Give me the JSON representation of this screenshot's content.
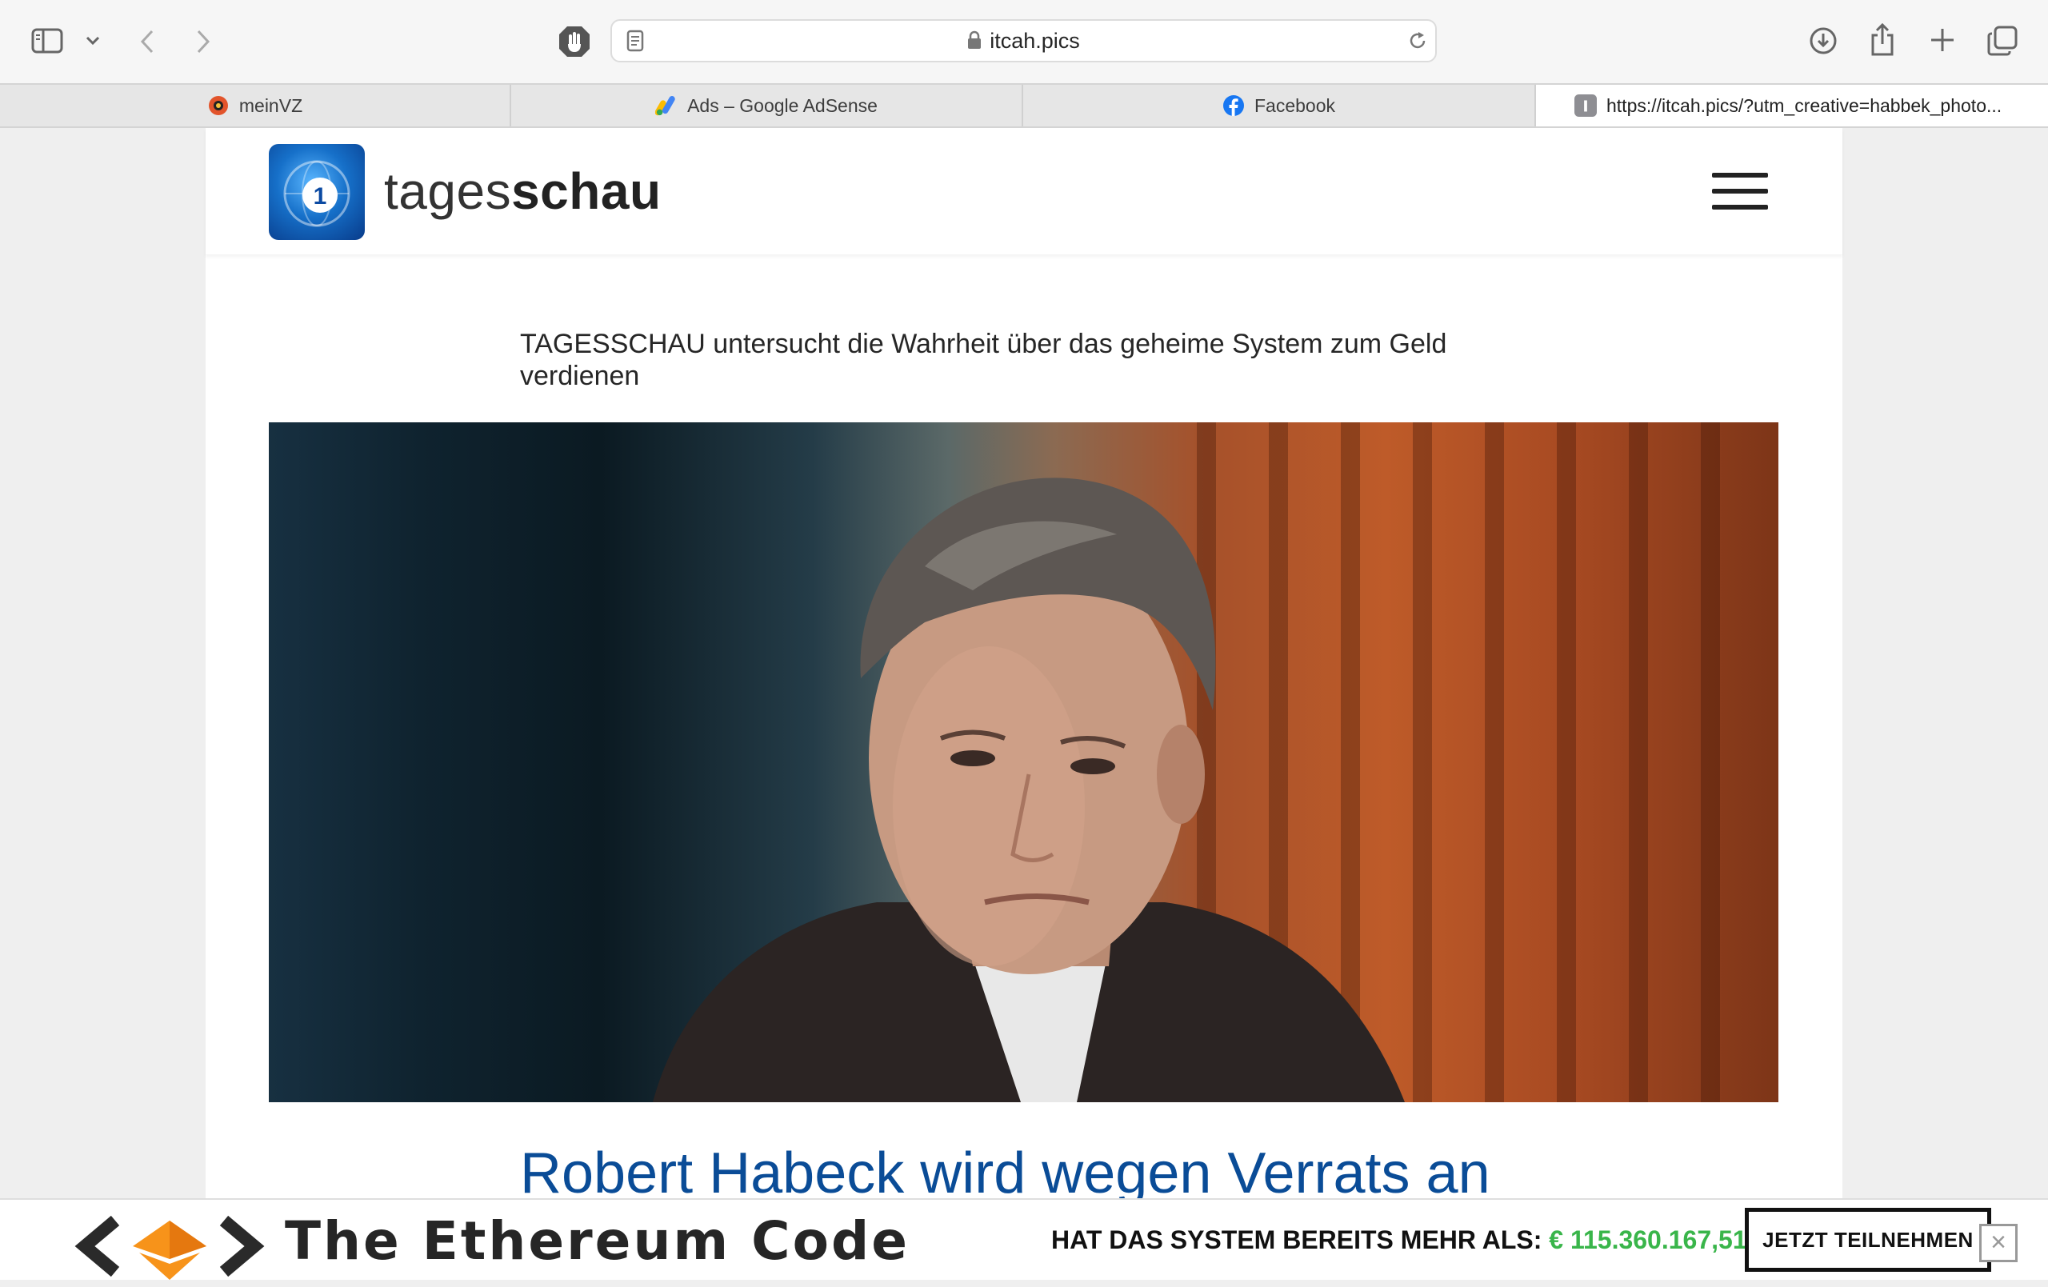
{
  "browser": {
    "url_display": "itcah.pics",
    "icons": [
      "sidebar-icon",
      "chevron-down-icon",
      "back-icon",
      "forward-icon",
      "privacy-hand-icon",
      "reader-icon",
      "lock-icon",
      "reload-icon",
      "download-icon",
      "share-icon",
      "new-tab-plus-icon",
      "tab-overview-icon"
    ],
    "tabs": [
      {
        "label": "meinVZ",
        "icon": "meinvz-icon",
        "active": false
      },
      {
        "label": "Ads – Google AdSense",
        "icon": "adsense-icon",
        "active": false
      },
      {
        "label": "Facebook",
        "icon": "facebook-icon",
        "active": false
      },
      {
        "label": "https://itcah.pics/?utm_creative=habbek_photo...",
        "icon": "site-favicon-icon",
        "active": true
      }
    ]
  },
  "site": {
    "logo_regular": "tages",
    "logo_bold": "schau",
    "menu_icon": "hamburger-menu-icon"
  },
  "article": {
    "lead": "TAGESSCHAU untersucht die Wahrheit über das geheime System zum Geld verdienen",
    "headline": "Robert Habeck wird wegen Verrats an"
  },
  "ad": {
    "brand": "The Ethereum Code",
    "claim": "HAT DAS SYSTEM BEREITS MEHR ALS:",
    "amount": "€ 115.360.167,51",
    "cta": "JETZT TEILNEHMEN",
    "close": "×"
  },
  "colors": {
    "headline": "#0a4c97",
    "amount": "#39b54a",
    "logo_blue": "#1670c9"
  }
}
